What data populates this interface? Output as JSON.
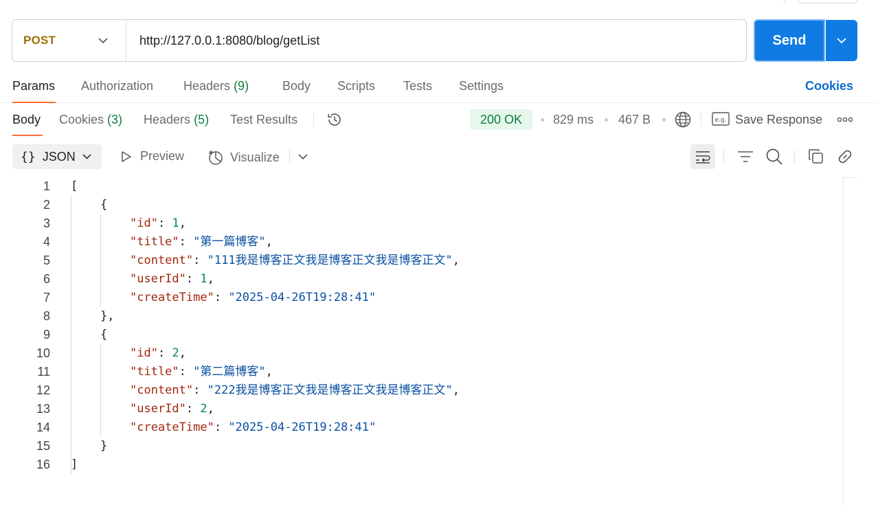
{
  "request": {
    "method": "POST",
    "url": "http://127.0.0.1:8080/blog/getList",
    "send_label": "Send"
  },
  "request_tabs": [
    {
      "label": "Params",
      "count": ""
    },
    {
      "label": "Authorization",
      "count": ""
    },
    {
      "label": "Headers",
      "count": "(9)"
    },
    {
      "label": "Body",
      "count": ""
    },
    {
      "label": "Scripts",
      "count": ""
    },
    {
      "label": "Tests",
      "count": ""
    },
    {
      "label": "Settings",
      "count": ""
    }
  ],
  "cookies_link": "Cookies",
  "response_tabs": [
    {
      "label": "Body",
      "count": ""
    },
    {
      "label": "Cookies",
      "count": "(3)"
    },
    {
      "label": "Headers",
      "count": "(5)"
    },
    {
      "label": "Test Results",
      "count": ""
    }
  ],
  "response_meta": {
    "status": "200 OK",
    "time": "829 ms",
    "size": "467 B",
    "save_label": "Save Response"
  },
  "toolbar": {
    "format": "JSON",
    "preview": "Preview",
    "visualize": "Visualize"
  },
  "code_lines": [
    {
      "n": "1",
      "indent": 0,
      "tokens": [
        {
          "t": "p",
          "v": "["
        }
      ]
    },
    {
      "n": "2",
      "indent": 1,
      "tokens": [
        {
          "t": "p",
          "v": "{"
        }
      ]
    },
    {
      "n": "3",
      "indent": 2,
      "tokens": [
        {
          "t": "k",
          "v": "\"id\""
        },
        {
          "t": "p",
          "v": ": "
        },
        {
          "t": "n",
          "v": "1"
        },
        {
          "t": "p",
          "v": ","
        }
      ]
    },
    {
      "n": "4",
      "indent": 2,
      "tokens": [
        {
          "t": "k",
          "v": "\"title\""
        },
        {
          "t": "p",
          "v": ": "
        },
        {
          "t": "s",
          "v": "\"第一篇博客\""
        },
        {
          "t": "p",
          "v": ","
        }
      ]
    },
    {
      "n": "5",
      "indent": 2,
      "tokens": [
        {
          "t": "k",
          "v": "\"content\""
        },
        {
          "t": "p",
          "v": ": "
        },
        {
          "t": "s",
          "v": "\"111我是博客正文我是博客正文我是博客正文\""
        },
        {
          "t": "p",
          "v": ","
        }
      ]
    },
    {
      "n": "6",
      "indent": 2,
      "tokens": [
        {
          "t": "k",
          "v": "\"userId\""
        },
        {
          "t": "p",
          "v": ": "
        },
        {
          "t": "n",
          "v": "1"
        },
        {
          "t": "p",
          "v": ","
        }
      ]
    },
    {
      "n": "7",
      "indent": 2,
      "tokens": [
        {
          "t": "k",
          "v": "\"createTime\""
        },
        {
          "t": "p",
          "v": ": "
        },
        {
          "t": "s",
          "v": "\"2025-04-26T19:28:41\""
        }
      ]
    },
    {
      "n": "8",
      "indent": 1,
      "tokens": [
        {
          "t": "p",
          "v": "},"
        }
      ]
    },
    {
      "n": "9",
      "indent": 1,
      "tokens": [
        {
          "t": "p",
          "v": "{"
        }
      ]
    },
    {
      "n": "10",
      "indent": 2,
      "tokens": [
        {
          "t": "k",
          "v": "\"id\""
        },
        {
          "t": "p",
          "v": ": "
        },
        {
          "t": "n",
          "v": "2"
        },
        {
          "t": "p",
          "v": ","
        }
      ]
    },
    {
      "n": "11",
      "indent": 2,
      "tokens": [
        {
          "t": "k",
          "v": "\"title\""
        },
        {
          "t": "p",
          "v": ": "
        },
        {
          "t": "s",
          "v": "\"第二篇博客\""
        },
        {
          "t": "p",
          "v": ","
        }
      ]
    },
    {
      "n": "12",
      "indent": 2,
      "tokens": [
        {
          "t": "k",
          "v": "\"content\""
        },
        {
          "t": "p",
          "v": ": "
        },
        {
          "t": "s",
          "v": "\"222我是博客正文我是博客正文我是博客正文\""
        },
        {
          "t": "p",
          "v": ","
        }
      ]
    },
    {
      "n": "13",
      "indent": 2,
      "tokens": [
        {
          "t": "k",
          "v": "\"userId\""
        },
        {
          "t": "p",
          "v": ": "
        },
        {
          "t": "n",
          "v": "2"
        },
        {
          "t": "p",
          "v": ","
        }
      ]
    },
    {
      "n": "14",
      "indent": 2,
      "tokens": [
        {
          "t": "k",
          "v": "\"createTime\""
        },
        {
          "t": "p",
          "v": ": "
        },
        {
          "t": "s",
          "v": "\"2025-04-26T19:28:41\""
        }
      ]
    },
    {
      "n": "15",
      "indent": 1,
      "tokens": [
        {
          "t": "p",
          "v": "}"
        }
      ]
    },
    {
      "n": "16",
      "indent": 0,
      "tokens": [
        {
          "t": "p",
          "v": "]"
        }
      ]
    }
  ],
  "colors": {
    "accent": "#0f7be3",
    "method": "#a0700b",
    "status_ok": "#0e7b3e",
    "tab_underline": "#ff6c37",
    "json_key": "#a1260d",
    "json_string": "#0a51a1",
    "json_number": "#098658"
  },
  "icons": [
    "chevron-down-icon",
    "history-icon",
    "globe-icon",
    "example-icon",
    "more-icon",
    "braces-icon",
    "play-icon",
    "visualize-icon",
    "wrap-icon",
    "filter-icon",
    "search-icon",
    "copy-icon",
    "link-icon"
  ]
}
